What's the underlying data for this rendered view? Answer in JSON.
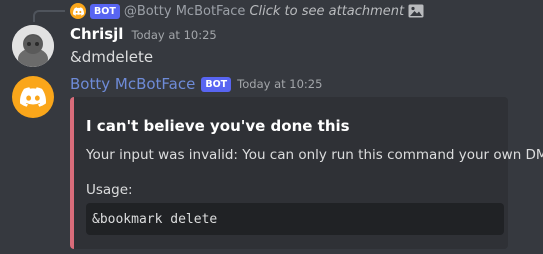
{
  "reply": {
    "bot_tag": "BOT",
    "mention": "@Botty McBotFace",
    "text": "Click to see attachment"
  },
  "message1": {
    "username": "Chrisjl",
    "timestamp": "Today at 10:25",
    "content": "&dmdelete"
  },
  "message2": {
    "username": "Botty McBotFace",
    "bot_tag": "BOT",
    "timestamp": "Today at 10:25",
    "embed": {
      "title": "I can't believe you've done this",
      "description": "Your input was invalid: You can only run this command your own DMs!",
      "field_label": "Usage:",
      "code": "&bookmark delete",
      "accent_color": "#d96c7a"
    }
  },
  "colors": {
    "background": "#36393f",
    "embed_bg": "#2f3136",
    "bot_avatar": "#faa61a",
    "bot_tag": "#5865f2",
    "bot_name": "#6e8bd8"
  }
}
